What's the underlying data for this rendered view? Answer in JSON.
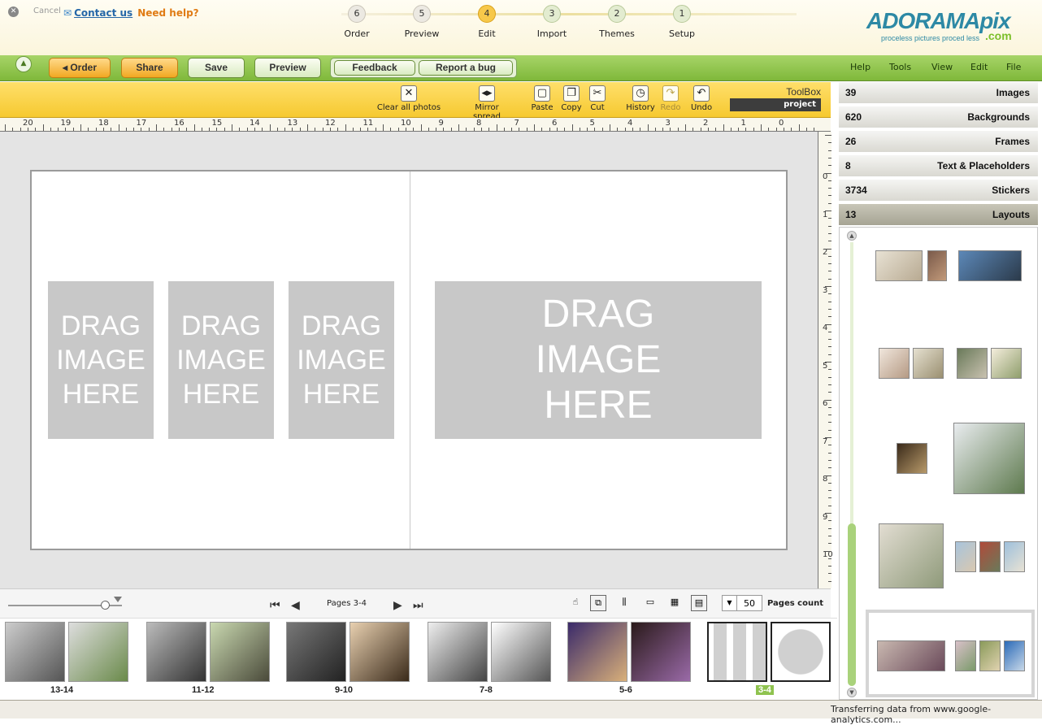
{
  "header": {
    "logo_main": "ADORAMApix",
    "logo_sub": "proceless pictures proced less",
    "logo_com": ".com",
    "steps": [
      {
        "num": "1",
        "label": "Setup",
        "state": "done"
      },
      {
        "num": "2",
        "label": "Themes",
        "state": "done"
      },
      {
        "num": "3",
        "label": "Import",
        "state": "done"
      },
      {
        "num": "4",
        "label": "Edit",
        "state": "active"
      },
      {
        "num": "5",
        "label": "Preview",
        "state": "future"
      },
      {
        "num": "6",
        "label": "Order",
        "state": "future"
      }
    ],
    "cancel_label": "Cancel",
    "need_help": "Need help?",
    "contact_us": "Contact us"
  },
  "menubar": {
    "menus": [
      "File",
      "Edit",
      "View",
      "Tools",
      "Help"
    ],
    "report_bug": "Report a bug",
    "feedback": "Feedback",
    "preview": "Preview",
    "save": "Save",
    "share": "Share",
    "order": "Order",
    "collapse_icon": "chevron-up-icon"
  },
  "toolbox": {
    "title": "ToolBox",
    "project_label": "project",
    "tools": [
      {
        "label": "Undo",
        "glyph": "↶",
        "icon": "undo-icon",
        "enabled": true
      },
      {
        "label": "Redo",
        "glyph": "↷",
        "icon": "redo-icon",
        "enabled": false
      },
      {
        "label": "History",
        "glyph": "◷",
        "icon": "history-icon",
        "enabled": true
      },
      {
        "label": "Cut",
        "glyph": "✂",
        "icon": "cut-icon",
        "enabled": true
      },
      {
        "label": "Copy",
        "glyph": "❐",
        "icon": "copy-icon",
        "enabled": true
      },
      {
        "label": "Paste",
        "glyph": "▢",
        "icon": "paste-icon",
        "enabled": true
      },
      {
        "label": "Mirror spread",
        "glyph": "◂▸",
        "icon": "mirror-icon",
        "enabled": true
      },
      {
        "label": "Clear all photos",
        "glyph": "✕",
        "icon": "clear-photos-icon",
        "enabled": true
      }
    ]
  },
  "ruler": {
    "h_numbers": [
      "0",
      "1",
      "2",
      "3",
      "4",
      "5",
      "6",
      "7",
      "8",
      "9",
      "10",
      "11",
      "12",
      "13",
      "14",
      "15",
      "16",
      "17",
      "18",
      "19",
      "20"
    ],
    "v_numbers": [
      "0",
      "1",
      "2",
      "3",
      "4",
      "5",
      "6",
      "7",
      "8",
      "9",
      "10"
    ]
  },
  "canvas": {
    "placeholder_text": [
      "DRAG",
      "IMAGE",
      "HERE"
    ]
  },
  "panel": {
    "categories": [
      {
        "label": "Images",
        "count": "39"
      },
      {
        "label": "Backgrounds",
        "count": "620"
      },
      {
        "label": "Frames",
        "count": "26"
      },
      {
        "label": "Text & Placeholders",
        "count": "8"
      },
      {
        "label": "Stickers",
        "count": "3734"
      },
      {
        "label": "Layouts",
        "count": "13",
        "open": true
      }
    ]
  },
  "bottombar": {
    "pages_label": "Pages 3-4",
    "pages_count_label": "Pages count",
    "pages_count_value": "50",
    "zoom_level": 0.85
  },
  "filmstrip": {
    "labels": [
      "3-4",
      "5-6",
      "7-8",
      "9-10",
      "11-12",
      "13-14"
    ],
    "selected": "3-4"
  },
  "status": {
    "text": "Transferring data from www.google-analytics.com..."
  },
  "colors": {
    "accent_green": "#8fc34f",
    "toolbox_yellow": "#f6c930",
    "order_orange": "#f1a822",
    "brand_blue": "#2d89a5"
  }
}
